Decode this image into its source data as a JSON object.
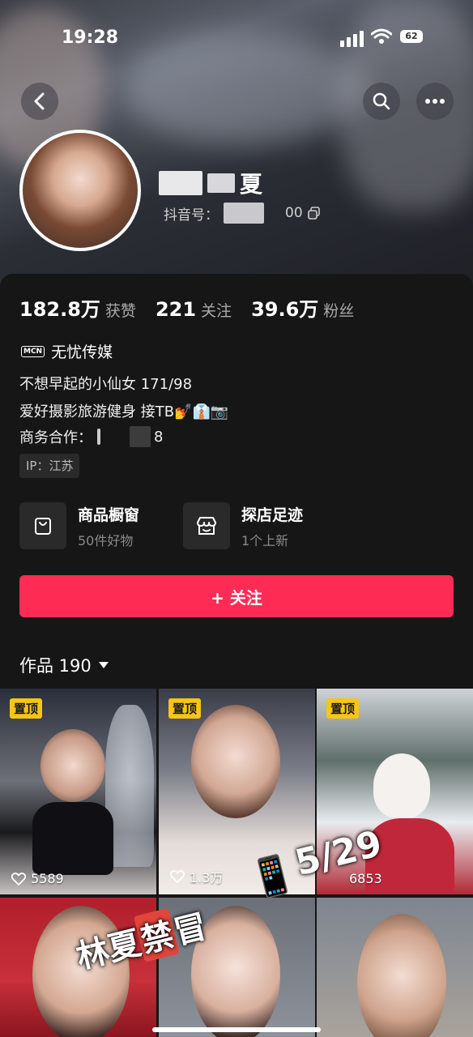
{
  "status_bar": {
    "time": "19:28",
    "battery": "62"
  },
  "profile": {
    "nickname": "夏",
    "douyin_id_label": "抖音号：",
    "douyin_id_value": "00"
  },
  "stats": [
    {
      "value": "182.8万",
      "label": "获赞"
    },
    {
      "value": "221",
      "label": "关注"
    },
    {
      "value": "39.6万",
      "label": "粉丝"
    }
  ],
  "mcn": {
    "badge": "MCN",
    "name": "无忧传媒"
  },
  "bio": {
    "line1": "不想早起的小仙女 171/98",
    "line2": "爱好摄影旅游健身  接TB💅👔📷",
    "line3_label": "商务合作：",
    "line3_tail": "8"
  },
  "ip": "IP：江苏",
  "cards": [
    {
      "title": "商品橱窗",
      "subtitle": "50件好物",
      "icon": "bag-icon"
    },
    {
      "title": "探店足迹",
      "subtitle": "1个上新",
      "icon": "shop-icon"
    }
  ],
  "follow_button": "+ 关注",
  "works": {
    "label": "作品 190"
  },
  "videos": [
    {
      "pinned": "置顶",
      "likes": "5589"
    },
    {
      "pinned": "置顶",
      "likes": "1.3万"
    },
    {
      "pinned": "置顶",
      "likes": "6853"
    },
    {
      "pinned": "",
      "likes": ""
    },
    {
      "pinned": "",
      "likes": ""
    },
    {
      "pinned": "",
      "likes": ""
    }
  ],
  "watermark": {
    "part1": "林夏",
    "part2": "禁",
    "part3": "冒",
    "phone_emoji": "📱",
    "date": "5/29"
  },
  "colors": {
    "accent": "#fe2c55",
    "pin": "#f5c518",
    "background": "#161616"
  }
}
